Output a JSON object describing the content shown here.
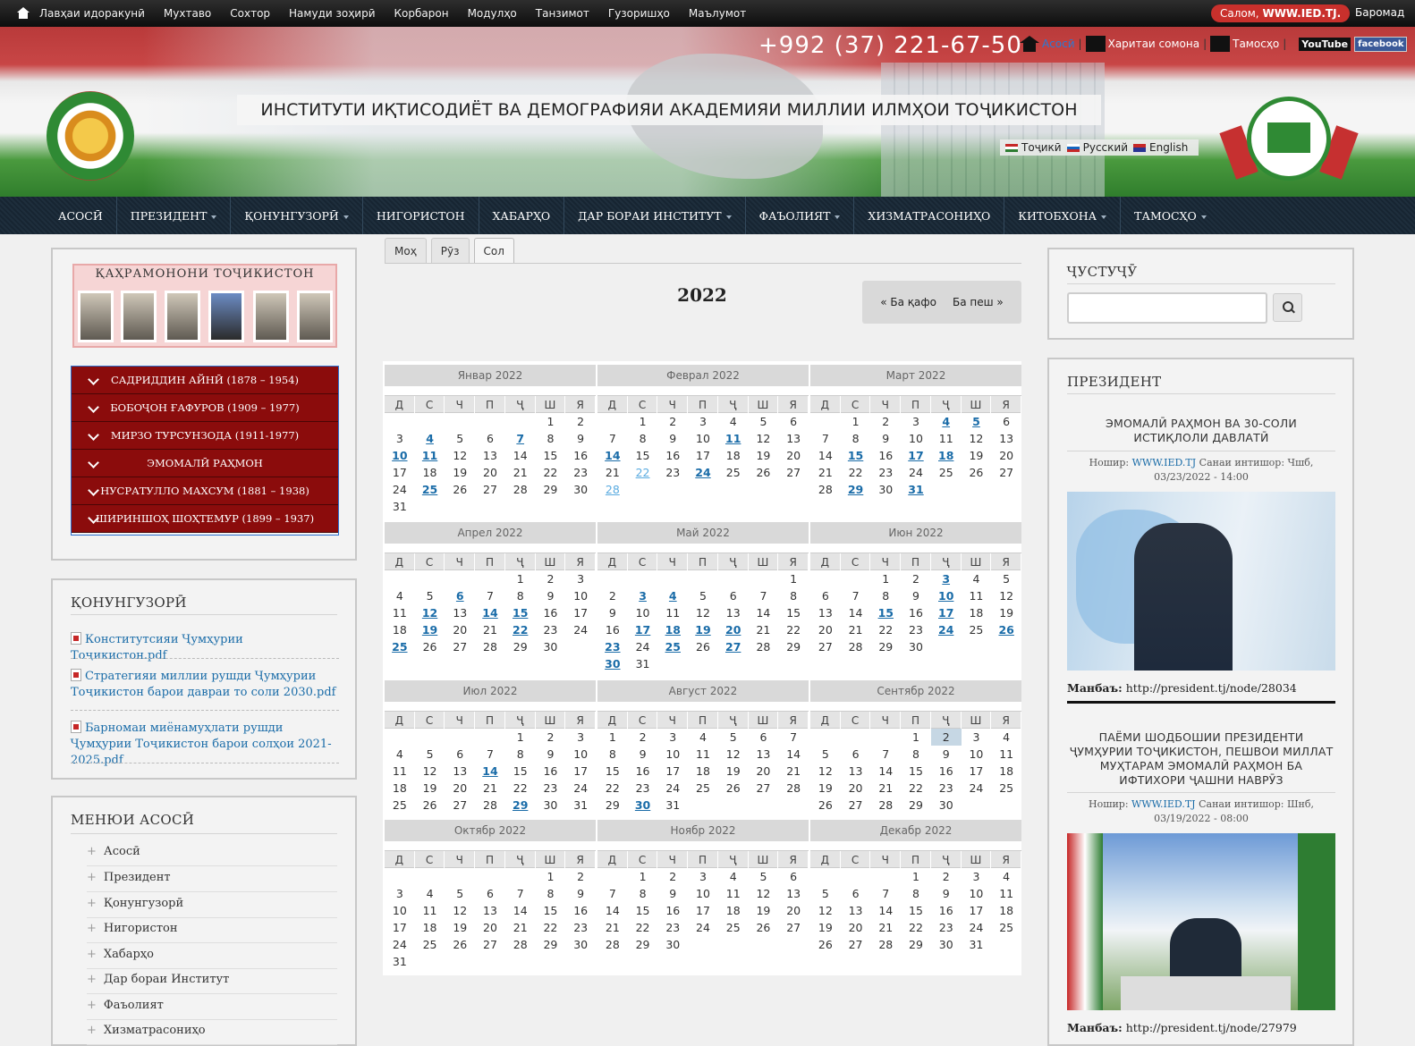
{
  "adminbar": {
    "items": [
      "Лавҳаи идоракунӣ",
      "Мухтаво",
      "Сохтор",
      "Намуди зоҳирӣ",
      "Корбарон",
      "Модулҳо",
      "Танзимот",
      "Гузоришҳо",
      "Маълумот"
    ],
    "greeting": "Салом,",
    "greeting_user": "WWW.IED.TJ.",
    "logout": "Баромад"
  },
  "header": {
    "phone": "+992 (37) 221-67-50",
    "home_link": "Асосӣ",
    "sitemap_link": "Харитаи сомона",
    "contact_link": "Тамосҳо",
    "youtube": "YouTube",
    "facebook": "facebook",
    "title": "ИНСТИТУТИ ИҚТИСОДИЁТ ВА ДЕМОГРАФИЯИ АКАДЕМИЯИ МИЛЛИИ ИЛМҲОИ ТОҶИКИСТОН",
    "langs": [
      {
        "label": "Тоҷикӣ",
        "flag": "#c62828"
      },
      {
        "label": "Русский",
        "flag": "#1565c0"
      },
      {
        "label": "English",
        "flag": "#283593"
      }
    ]
  },
  "mainnav": [
    {
      "label": "АСОСӢ",
      "dropdown": false
    },
    {
      "label": "ПРЕЗИДЕНТ",
      "dropdown": true
    },
    {
      "label": "ҚОНУНГУЗОРӢ",
      "dropdown": true
    },
    {
      "label": "НИГОРИСТОН",
      "dropdown": false
    },
    {
      "label": "ХАБАРҲО",
      "dropdown": false
    },
    {
      "label": "ДАР БОРАИ ИНСТИТУТ",
      "dropdown": true
    },
    {
      "label": "ФАЪОЛИЯТ",
      "dropdown": true
    },
    {
      "label": "ХИЗМАТРАСОНИҲО",
      "dropdown": false
    },
    {
      "label": "КИТОБХОНА",
      "dropdown": true
    },
    {
      "label": "ТАМОСҲО",
      "dropdown": true
    }
  ],
  "heroes": {
    "banner_title": "ҚАҲРАМОНОНИ ТОҶИКИСТОН",
    "items": [
      "САДРИДДИН АЙНӢ (1878 – 1954)",
      "БОБОҶОН ҒАФУРОВ (1909 – 1977)",
      "МИРЗО ТУРСУНЗОДА (1911-1977)",
      "ЭМОМАЛӢ РАҲМОН",
      "НУСРАТУЛЛО МАХСУМ (1881 – 1938)",
      "ШИРИНШОҲ ШОҲТЕМУР (1899 – 1937)"
    ]
  },
  "law": {
    "title": "ҚОНУНГУЗОРӢ",
    "docs": [
      "Конститутсияи Ҷумҳурии Тоҷикистон.pdf",
      "Стратегияи миллии рушди Ҷумҳурии Тоҷикистон барои давраи то соли 2030.pdf",
      "Барномаи миёнамуҳлати рушди Ҷумҳурии Тоҷикистон барои солҳои 2021-2025.pdf"
    ]
  },
  "mainmenu": {
    "title": "МЕНЮИ АСОСӢ",
    "items": [
      "Асосӣ",
      "Президент",
      "Қонунгузорӣ",
      "Нигористон",
      "Хабарҳо",
      "Дар бораи Институт",
      "Фаъолият",
      "Хизматрасониҳо"
    ]
  },
  "calendar": {
    "tabs": [
      "Моҳ",
      "Рӯз",
      "Сол"
    ],
    "active_tab": 2,
    "year": "2022",
    "prev": "« Ба қафо",
    "next": "Ба пеш »",
    "weekdays": [
      "Д",
      "С",
      "Ч",
      "П",
      "Ҷ",
      "Ш",
      "Я"
    ],
    "months": [
      {
        "name": "Январ 2022",
        "offset": 5,
        "days": 31,
        "links": [
          4,
          7,
          10,
          11,
          25
        ],
        "today": []
      },
      {
        "name": "Феврал 2022",
        "offset": 1,
        "days": 28,
        "links": [
          11,
          14,
          24
        ],
        "today": [
          22,
          28
        ]
      },
      {
        "name": "Март 2022",
        "offset": 1,
        "days": 31,
        "links": [
          4,
          5,
          15,
          17,
          18,
          29,
          31
        ],
        "today": []
      },
      {
        "name": "Апрел 2022",
        "offset": 4,
        "days": 30,
        "links": [
          6,
          12,
          14,
          15,
          19,
          22,
          25
        ],
        "today": []
      },
      {
        "name": "Май 2022",
        "offset": 6,
        "days": 31,
        "links": [
          3,
          4,
          17,
          18,
          19,
          20,
          23,
          25,
          27,
          30
        ],
        "today": []
      },
      {
        "name": "Июн 2022",
        "offset": 2,
        "days": 30,
        "links": [
          3,
          10,
          15,
          17,
          24,
          26
        ],
        "today": []
      },
      {
        "name": "Июл 2022",
        "offset": 4,
        "days": 31,
        "links": [
          14,
          29
        ],
        "today": []
      },
      {
        "name": "Август 2022",
        "offset": 0,
        "days": 31,
        "links": [
          30
        ],
        "today": []
      },
      {
        "name": "Сентябр 2022",
        "offset": 3,
        "days": 30,
        "links": [],
        "today": [],
        "highlight": [
          2
        ]
      },
      {
        "name": "Октябр 2022",
        "offset": 5,
        "days": 31,
        "links": [],
        "today": []
      },
      {
        "name": "Ноябр 2022",
        "offset": 1,
        "days": 30,
        "links": [],
        "today": []
      },
      {
        "name": "Декабр 2022",
        "offset": 3,
        "days": 31,
        "links": [],
        "today": []
      }
    ]
  },
  "search": {
    "title": "ҶУСТУҶӮ",
    "value": ""
  },
  "president": {
    "title": "ПРЕЗИДЕНТ",
    "news": [
      {
        "title": "ЭМОМАЛӢ РАҲМОН ВА 30-СОЛИ ИСТИҚЛОЛИ ДАВЛАТӢ",
        "author_label": "Ношир:",
        "author": "WWW.IED.TJ",
        "date_label": "Санаи интишор:",
        "date": "Чшб, 03/23/2022 - 14:00",
        "source_label": "Манбаъ:",
        "source": "http://president.tj/node/28034"
      },
      {
        "title": "ПАЁМИ ШОДБОШИИ ПРЕЗИДЕНТИ ҶУМҲУРИИ ТОҶИКИСТОН, ПЕШВОИ МИЛЛАТ МУҲТАРАМ ЭМОМАЛӢ РАҲМОН БА ИФТИХОРИ ҶАШНИ НАВРӮЗ",
        "author_label": "Ношир:",
        "author": "WWW.IED.TJ",
        "date_label": "Санаи интишор:",
        "date": "Шнб, 03/19/2022 - 08:00",
        "source_label": "Манбаъ:",
        "source": "http://president.tj/node/27979"
      }
    ]
  }
}
